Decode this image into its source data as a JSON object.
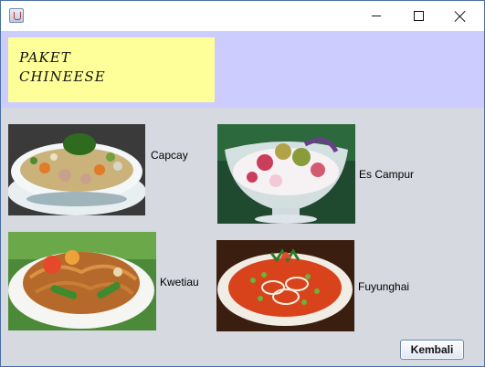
{
  "window": {
    "title": "",
    "controls": {
      "minimize_icon": "minimize-icon",
      "maximize_icon": "maximize-icon",
      "close_icon": "close-icon"
    }
  },
  "banner": {
    "line1": "PAKET",
    "line2": "CHINEESE"
  },
  "menu_items": [
    {
      "label": "Capcay",
      "image": "capcay-photo"
    },
    {
      "label": "Es Campur",
      "image": "es-campur-photo"
    },
    {
      "label": "Kwetiau",
      "image": "kwetiau-photo"
    },
    {
      "label": "Fuyunghai",
      "image": "fuyunghai-photo"
    }
  ],
  "buttons": {
    "back_label": "Kembali"
  },
  "colors": {
    "header_bg": "#ccccff",
    "banner_bg": "#ffff99",
    "content_bg": "#d6d9df"
  }
}
